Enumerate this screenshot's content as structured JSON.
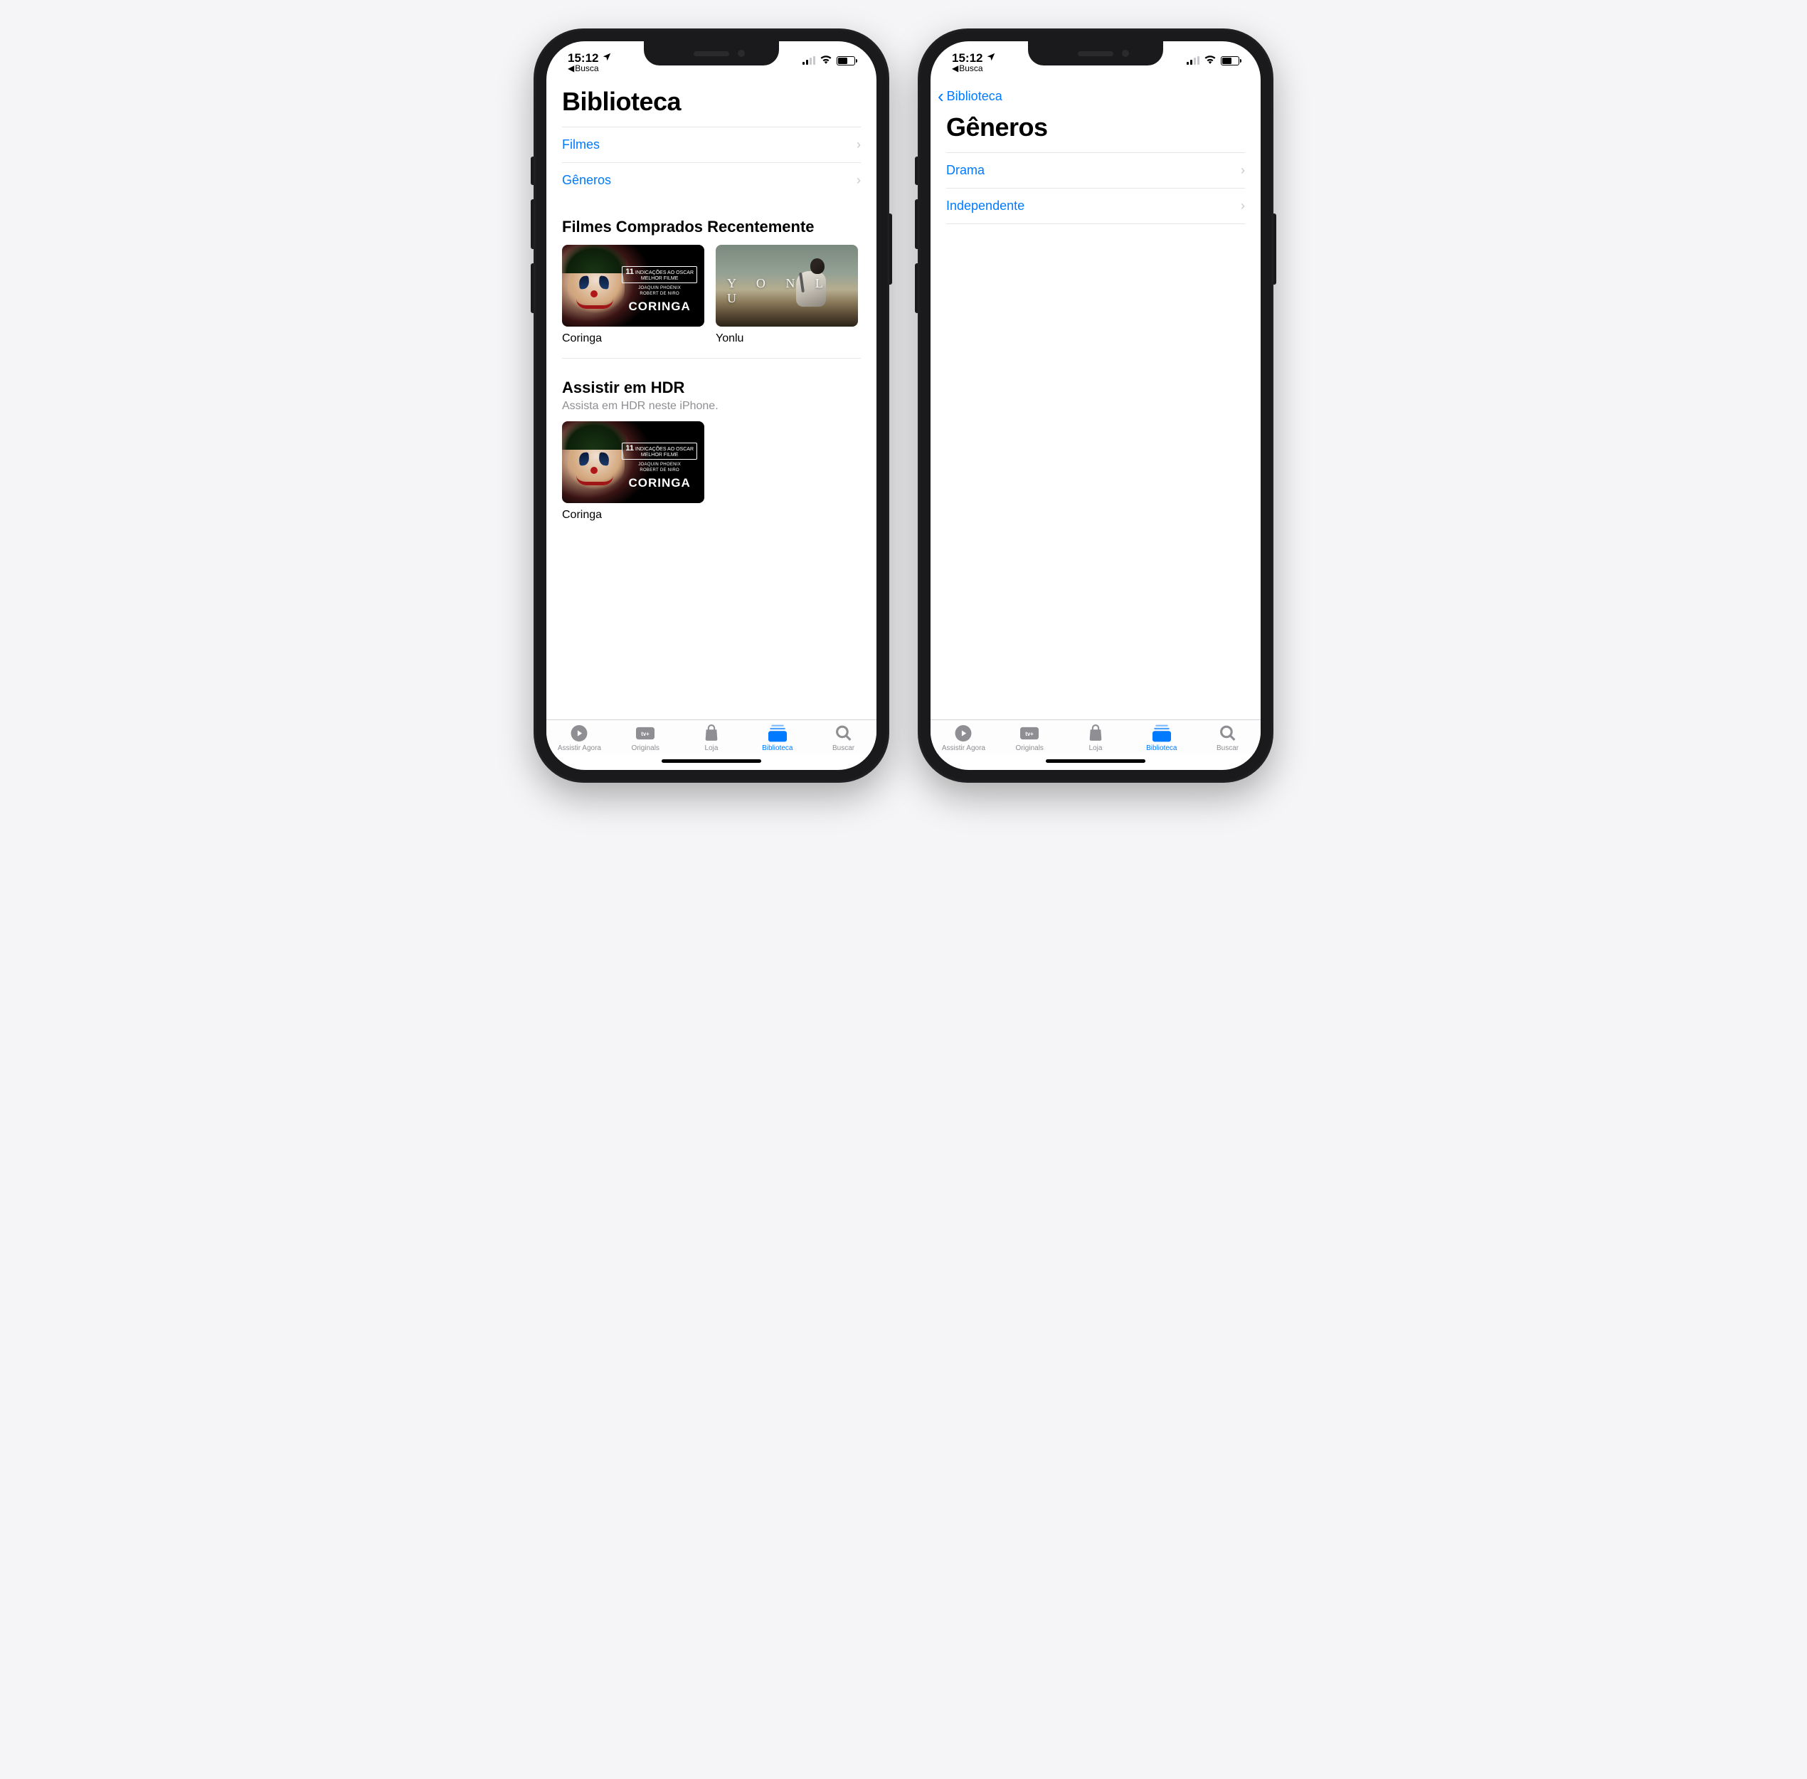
{
  "status": {
    "time": "15:12",
    "back_app": "Busca"
  },
  "left_screen": {
    "title": "Biblioteca",
    "rows": [
      "Filmes",
      "Gêneros"
    ],
    "section1": {
      "title": "Filmes Comprados Recentemente",
      "items": [
        {
          "title": "Coringa",
          "poster_main_text": "CORINGA",
          "poster_badge_num": "11",
          "poster_badge_sub": "INDICAÇÕES AO OSCAR",
          "poster_badge_line": "MELHOR FILME",
          "poster_actors": "JOAQUIN PHOENIX\nROBERT DE NIRO"
        },
        {
          "title": "Yonlu",
          "poster_main_text": "Y O N L U"
        }
      ]
    },
    "section2": {
      "title": "Assistir em HDR",
      "subtitle": "Assista em HDR neste iPhone.",
      "items": [
        {
          "title": "Coringa",
          "poster_main_text": "CORINGA",
          "poster_badge_num": "11",
          "poster_badge_sub": "INDICAÇÕES AO OSCAR",
          "poster_badge_line": "MELHOR FILME",
          "poster_actors": "JOAQUIN PHOENIX\nROBERT DE NIRO"
        }
      ]
    }
  },
  "right_screen": {
    "back_label": "Biblioteca",
    "title": "Gêneros",
    "rows": [
      "Drama",
      "Independente"
    ]
  },
  "tabs": {
    "items": [
      "Assistir Agora",
      "Originals",
      "Loja",
      "Biblioteca",
      "Buscar"
    ],
    "active_index": 3
  },
  "colors": {
    "tint": "#007aff",
    "inactive": "#8e8e93"
  }
}
